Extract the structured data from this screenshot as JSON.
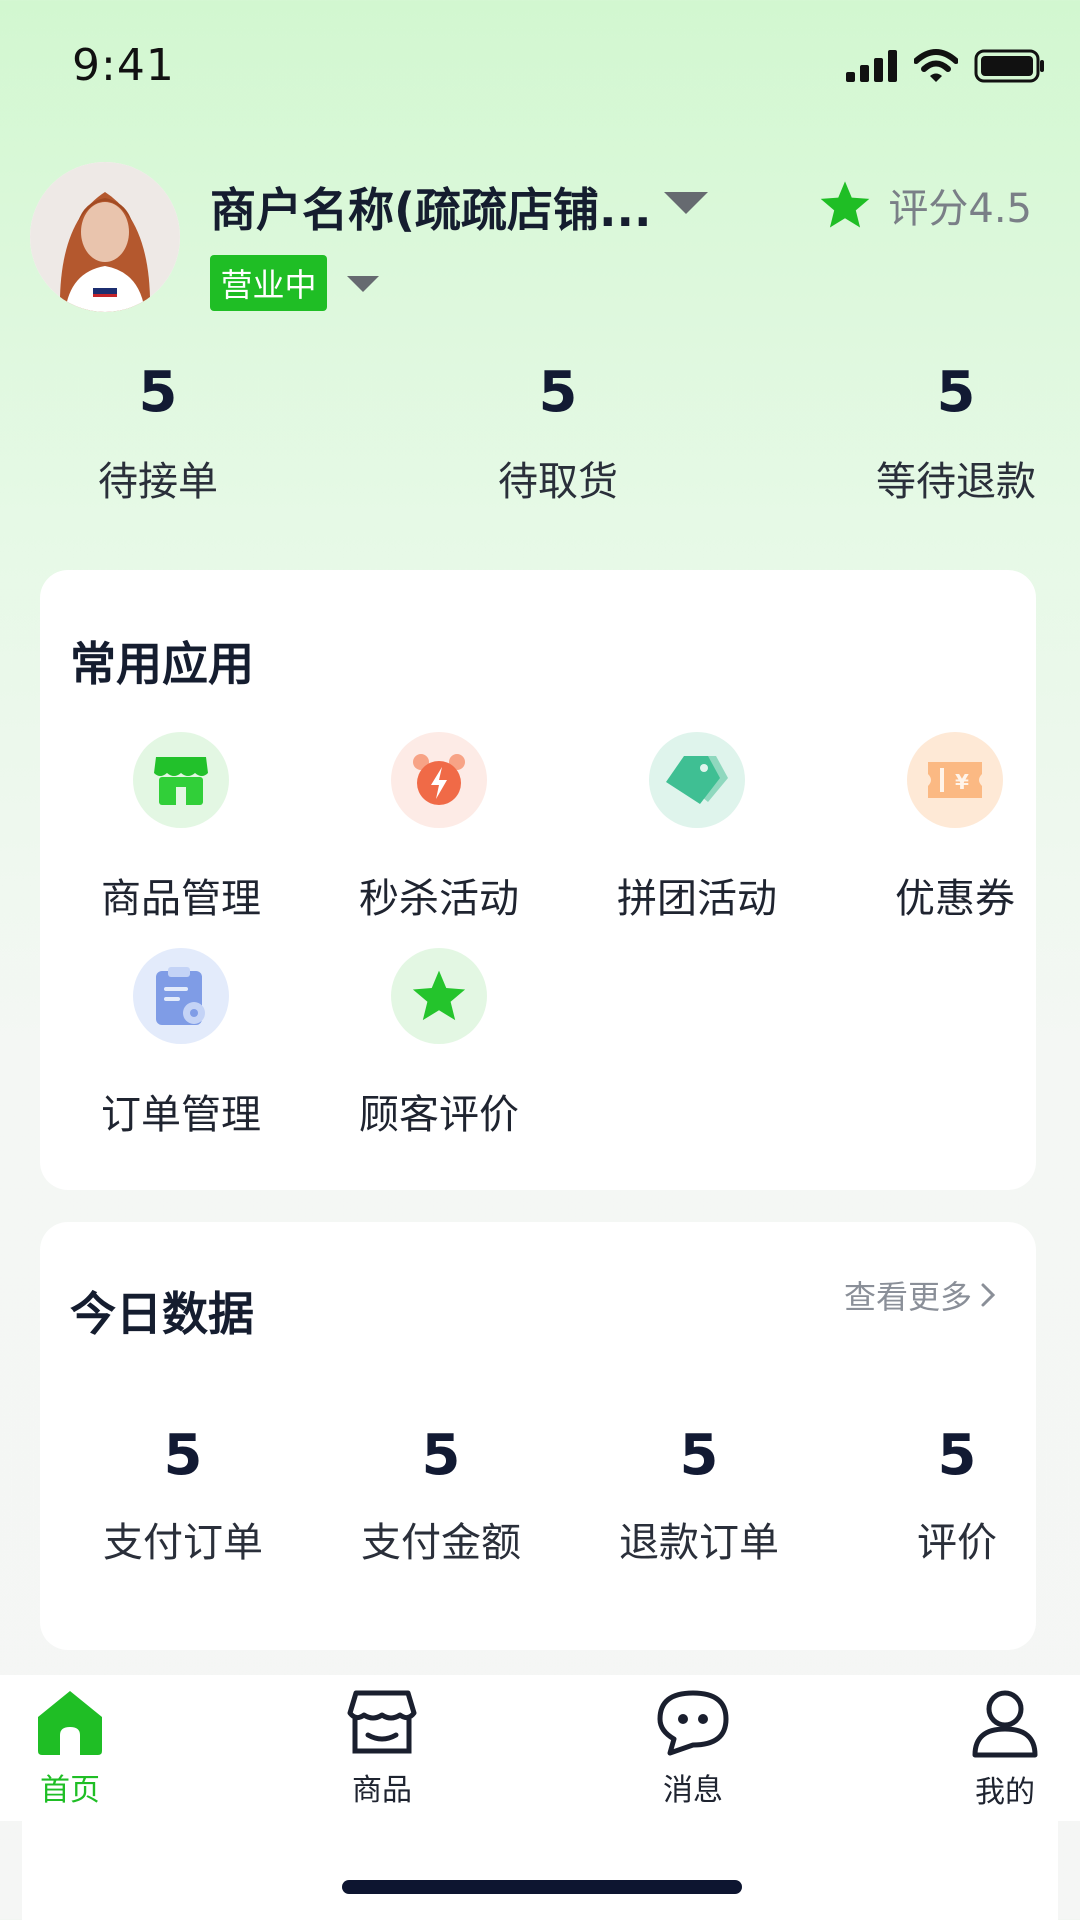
{
  "status_bar": {
    "time": "9:41"
  },
  "header": {
    "store_name": "商户名称(疏疏店铺...",
    "status_label": "营业中",
    "rating_label": "评分4.5"
  },
  "top_stats": [
    {
      "value": "5",
      "label": "待接单"
    },
    {
      "value": "5",
      "label": "待取货"
    },
    {
      "value": "5",
      "label": "等待退款"
    }
  ],
  "common_apps": {
    "title": "常用应用",
    "items": [
      {
        "label": "商品管理",
        "icon": "store-icon"
      },
      {
        "label": "秒杀活动",
        "icon": "alarm-bolt-icon"
      },
      {
        "label": "拼团活动",
        "icon": "tag-icon"
      },
      {
        "label": "优惠券",
        "icon": "coupon-icon"
      },
      {
        "label": "订单管理",
        "icon": "clipboard-icon"
      },
      {
        "label": "顾客评价",
        "icon": "star-icon"
      }
    ]
  },
  "today_data": {
    "title": "今日数据",
    "more_label": "查看更多",
    "stats": [
      {
        "value": "5",
        "label": "支付订单"
      },
      {
        "value": "5",
        "label": "支付金额"
      },
      {
        "value": "5",
        "label": "退款订单"
      },
      {
        "value": "5",
        "label": "评价"
      }
    ]
  },
  "tab_bar": {
    "tabs": [
      {
        "label": "首页",
        "icon": "home-icon",
        "active": true
      },
      {
        "label": "商品",
        "icon": "shop-icon",
        "active": false
      },
      {
        "label": "消息",
        "icon": "message-icon",
        "active": false
      },
      {
        "label": "我的",
        "icon": "user-icon",
        "active": false
      }
    ]
  },
  "colors": {
    "accent": "#1fbe25",
    "text_dark": "#151d2f",
    "muted": "#8a8f98"
  }
}
